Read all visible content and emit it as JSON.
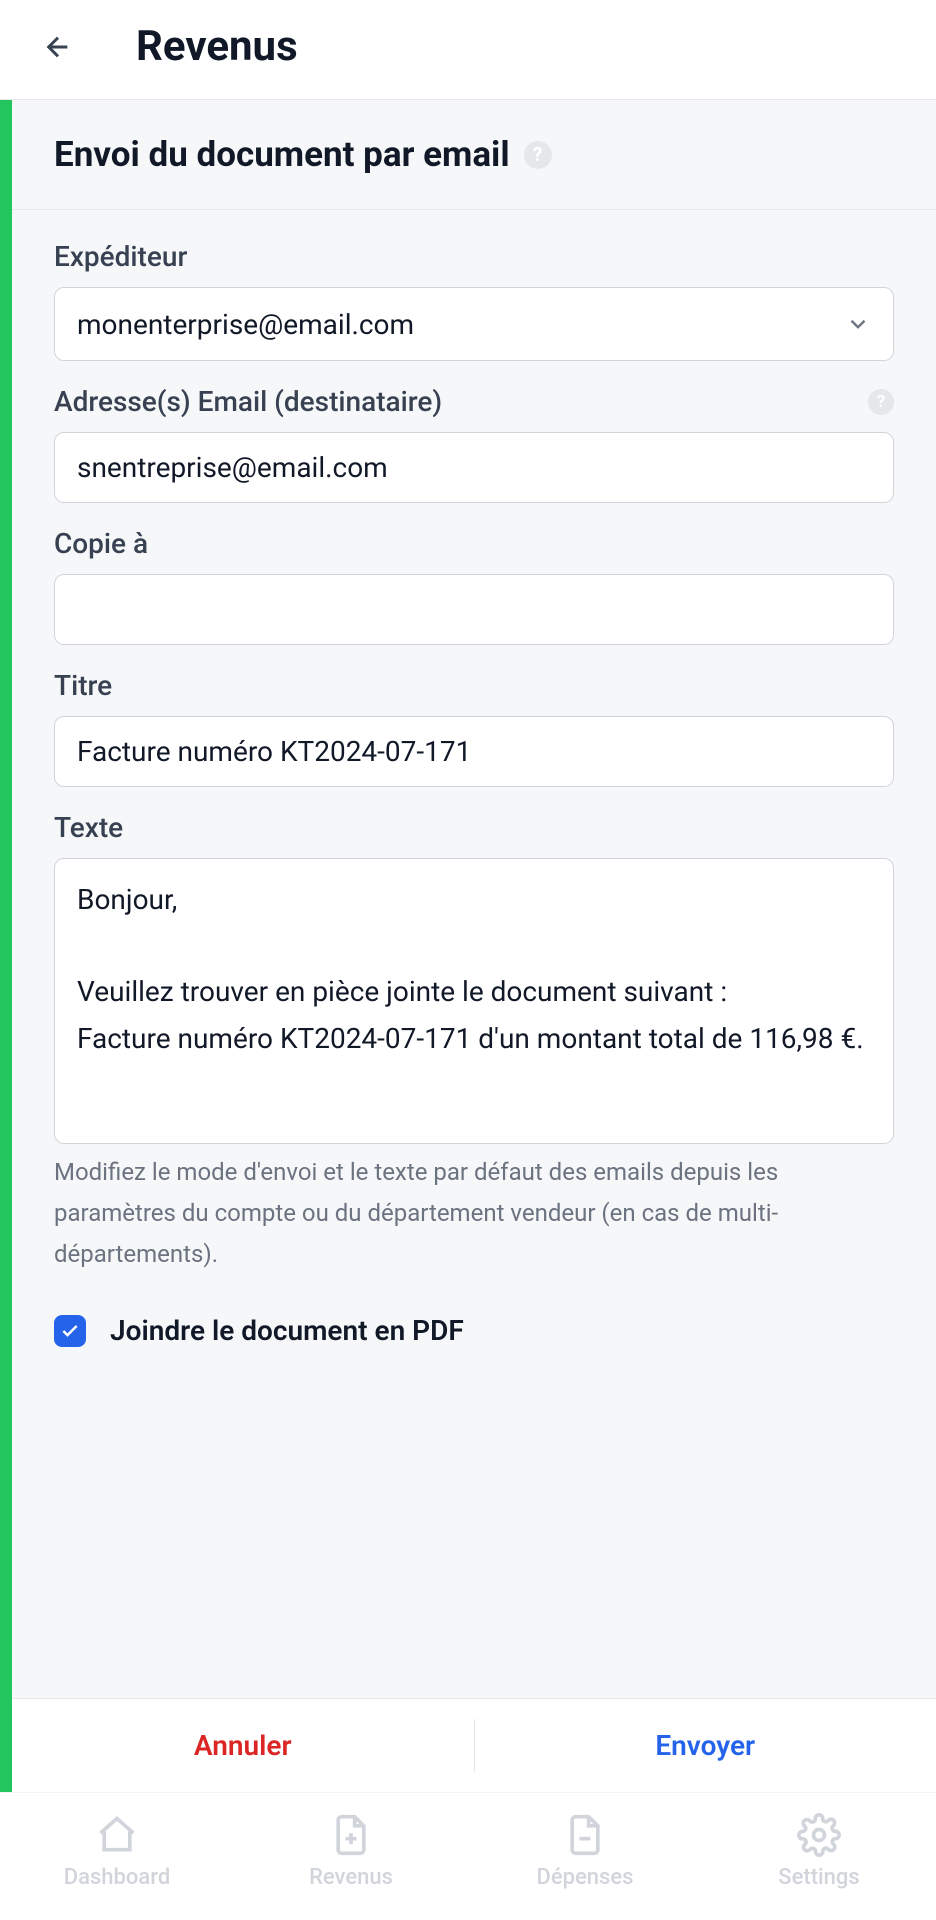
{
  "header": {
    "title": "Revenus"
  },
  "panel": {
    "title": "Envoi du document par email"
  },
  "fields": {
    "sender": {
      "label": "Expéditeur",
      "value": "monenterprise@email.com"
    },
    "recipients": {
      "label": "Adresse(s) Email (destinataire)",
      "value": "snentreprise@email.com"
    },
    "cc": {
      "label": "Copie à",
      "value": ""
    },
    "subject": {
      "label": "Titre",
      "value": "Facture numéro KT2024-07-171"
    },
    "body": {
      "label": "Texte",
      "value": "Bonjour,\n\nVeuillez trouver en pièce jointe le document suivant :\nFacture numéro KT2024-07-171 d'un montant total de 116,98 €."
    },
    "helper_text": "Modifiez le mode d'envoi et le texte par défaut des emails depuis les paramètres du compte ou du département vendeur (en cas de multi-départements).",
    "attach_pdf": {
      "label": "Joindre le document en PDF",
      "checked": true
    }
  },
  "actions": {
    "cancel": "Annuler",
    "submit": "Envoyer"
  },
  "nav": {
    "dashboard": "Dashboard",
    "revenus": "Revenus",
    "depenses": "Dépenses",
    "settings": "Settings"
  }
}
